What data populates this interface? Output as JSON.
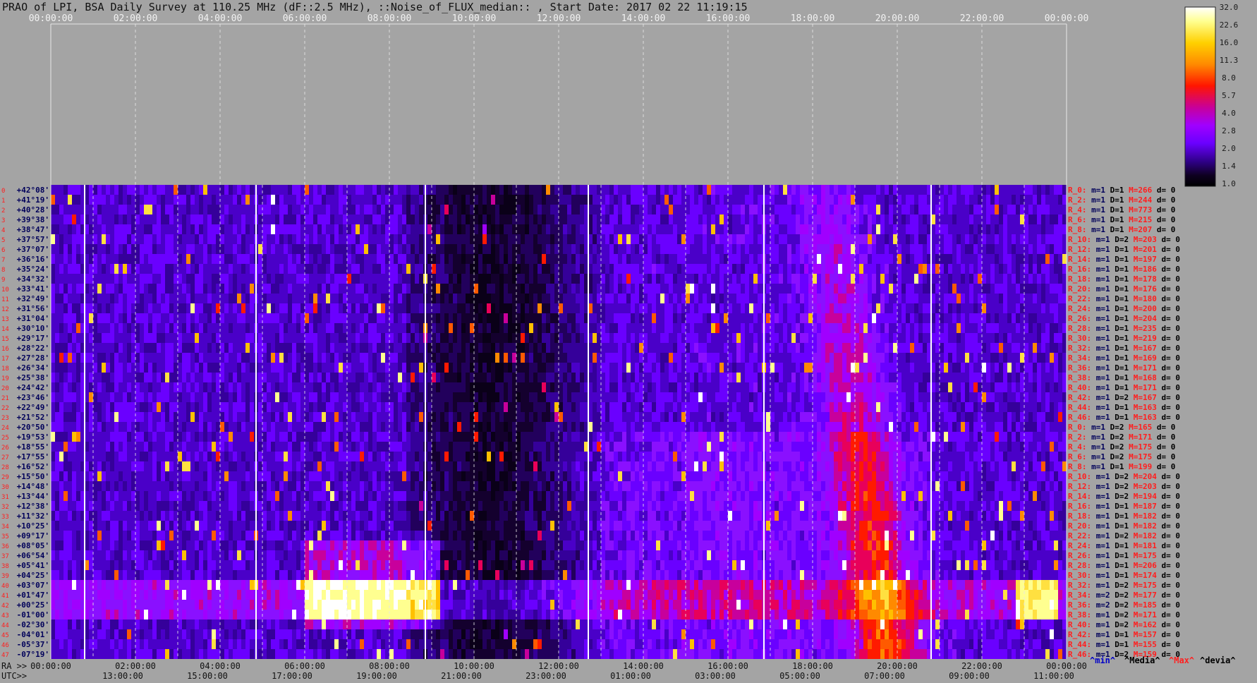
{
  "title": "PRAO of LPI, BSA Daily Survey at 110.25 MHz (dF::2.5 MHz), ::Noise_of_FLUX_median:: , Start Date: 2017 02 22 11:19:15",
  "colorbar": {
    "labels": [
      "32.0",
      "22.6",
      "16.0",
      "11.3",
      "8.0",
      "5.7",
      "4.0",
      "2.8",
      "2.0",
      "1.4",
      "1.0"
    ],
    "colors": [
      "#ffffff",
      "#ffff80",
      "#ffd400",
      "#ff8a00",
      "#ff1a00",
      "#c8008c",
      "#a000ff",
      "#6a00ff",
      "#35009a",
      "#14002e",
      "#000000"
    ]
  },
  "footer": {
    "ra_label": "RA >>",
    "utc_label": "UTC>>",
    "min_label": "^min^",
    "media_label": "^Media^",
    "max_label": "^Max^",
    "devia_label": "^devia^"
  },
  "chart_data": {
    "type": "heatmap",
    "top_time_labels": [
      "00:00:00",
      "02:00:00",
      "04:00:00",
      "06:00:00",
      "08:00:00",
      "10:00:00",
      "12:00:00",
      "14:00:00",
      "16:00:00",
      "18:00:00",
      "20:00:00",
      "22:00:00",
      "00:00:00"
    ],
    "ra_time_labels": [
      "00:00:00",
      "02:00:00",
      "04:00:00",
      "06:00:00",
      "08:00:00",
      "10:00:00",
      "12:00:00",
      "14:00:00",
      "16:00:00",
      "18:00:00",
      "20:00:00",
      "22:00:00",
      "00:00:00"
    ],
    "utc_time_labels": [
      "13:00:00",
      "15:00:00",
      "17:00:00",
      "19:00:00",
      "21:00:00",
      "23:00:00",
      "01:00:00",
      "03:00:00",
      "05:00:00",
      "07:00:00",
      "09:00:00",
      "11:00:00"
    ],
    "declinations": [
      "+42°08'",
      "+41°19'",
      "+40°28'",
      "+39°38'",
      "+38°47'",
      "+37°57'",
      "+37°07'",
      "+36°16'",
      "+35°24'",
      "+34°32'",
      "+33°41'",
      "+32°49'",
      "+31°56'",
      "+31°04'",
      "+30°10'",
      "+29°17'",
      "+28°22'",
      "+27°28'",
      "+26°34'",
      "+25°38'",
      "+24°42'",
      "+23°46'",
      "+22°49'",
      "+21°52'",
      "+20°50'",
      "+19°53'",
      "+18°55'",
      "+17°55'",
      "+16°52'",
      "+15°50'",
      "+14°48'",
      "+13°44'",
      "+12°38'",
      "+11°32'",
      "+10°25'",
      "+09°17'",
      "+08°05'",
      "+06°54'",
      "+05°41'",
      "+04°25'",
      "+03°07'",
      "+01°47'",
      "+00°25'",
      "-01°00'",
      "-02°30'",
      "-04°01'",
      "-05°37'",
      "-07°19'"
    ],
    "row_numbers": [
      "0",
      "1",
      "2",
      "3",
      "4",
      "5",
      "6",
      "7",
      "8",
      "9",
      "10",
      "11",
      "12",
      "13",
      "14",
      "15",
      "16",
      "17",
      "18",
      "19",
      "20",
      "21",
      "22",
      "23",
      "24",
      "25",
      "26",
      "27",
      "28",
      "29",
      "30",
      "31",
      "32",
      "33",
      "34",
      "35",
      "36",
      "37",
      "38",
      "39",
      "40",
      "41",
      "42",
      "43",
      "44",
      "45",
      "46",
      "47"
    ],
    "right_stats": [
      {
        "r": "R_0:",
        "min": "m=1",
        "d1": "D=1",
        "max": "M=266",
        "dev": "d= 0"
      },
      {
        "r": "R_2:",
        "min": "m=1",
        "d1": "D=1",
        "max": "M=244",
        "dev": "d= 0"
      },
      {
        "r": "R_4:",
        "min": "m=1",
        "d1": "D=1",
        "max": "M=773",
        "dev": "d= 0"
      },
      {
        "r": "R_6:",
        "min": "m=1",
        "d1": "D=1",
        "max": "M=215",
        "dev": "d= 0"
      },
      {
        "r": "R_8:",
        "min": "m=1",
        "d1": "D=1",
        "max": "M=207",
        "dev": "d= 0"
      },
      {
        "r": "R_10:",
        "min": "m=1",
        "d1": "D=2",
        "max": "M=203",
        "dev": "d= 0"
      },
      {
        "r": "R_12:",
        "min": "m=1",
        "d1": "D=1",
        "max": "M=201",
        "dev": "d= 0"
      },
      {
        "r": "R_14:",
        "min": "m=1",
        "d1": "D=1",
        "max": "M=197",
        "dev": "d= 0"
      },
      {
        "r": "R_16:",
        "min": "m=1",
        "d1": "D=1",
        "max": "M=186",
        "dev": "d= 0"
      },
      {
        "r": "R_18:",
        "min": "m=1",
        "d1": "D=1",
        "max": "M=178",
        "dev": "d= 0"
      },
      {
        "r": "R_20:",
        "min": "m=1",
        "d1": "D=1",
        "max": "M=176",
        "dev": "d= 0"
      },
      {
        "r": "R_22:",
        "min": "m=1",
        "d1": "D=1",
        "max": "M=180",
        "dev": "d= 0"
      },
      {
        "r": "R_24:",
        "min": "m=1",
        "d1": "D=1",
        "max": "M=200",
        "dev": "d= 0"
      },
      {
        "r": "R_26:",
        "min": "m=1",
        "d1": "D=1",
        "max": "M=204",
        "dev": "d= 0"
      },
      {
        "r": "R_28:",
        "min": "m=1",
        "d1": "D=1",
        "max": "M=235",
        "dev": "d= 0"
      },
      {
        "r": "R_30:",
        "min": "m=1",
        "d1": "D=1",
        "max": "M=219",
        "dev": "d= 0"
      },
      {
        "r": "R_32:",
        "min": "m=1",
        "d1": "D=1",
        "max": "M=167",
        "dev": "d= 0"
      },
      {
        "r": "R_34:",
        "min": "m=1",
        "d1": "D=1",
        "max": "M=169",
        "dev": "d= 0"
      },
      {
        "r": "R_36:",
        "min": "m=1",
        "d1": "D=1",
        "max": "M=171",
        "dev": "d= 0"
      },
      {
        "r": "R_38:",
        "min": "m=1",
        "d1": "D=1",
        "max": "M=168",
        "dev": "d= 0"
      },
      {
        "r": "R_40:",
        "min": "m=1",
        "d1": "D=1",
        "max": "M=171",
        "dev": "d= 0"
      },
      {
        "r": "R_42:",
        "min": "m=1",
        "d1": "D=2",
        "max": "M=167",
        "dev": "d= 0"
      },
      {
        "r": "R_44:",
        "min": "m=1",
        "d1": "D=1",
        "max": "M=163",
        "dev": "d= 0"
      },
      {
        "r": "R_46:",
        "min": "m=1",
        "d1": "D=1",
        "max": "M=163",
        "dev": "d= 0"
      },
      {
        "r": "R_0:",
        "min": "m=1",
        "d1": "D=2",
        "max": "M=165",
        "dev": "d= 0"
      },
      {
        "r": "R_2:",
        "min": "m=1",
        "d1": "D=2",
        "max": "M=171",
        "dev": "d= 0"
      },
      {
        "r": "R_4:",
        "min": "m=1",
        "d1": "D=2",
        "max": "M=175",
        "dev": "d= 0"
      },
      {
        "r": "R_6:",
        "min": "m=1",
        "d1": "D=2",
        "max": "M=175",
        "dev": "d= 0"
      },
      {
        "r": "R_8:",
        "min": "m=1",
        "d1": "D=1",
        "max": "M=199",
        "dev": "d= 0"
      },
      {
        "r": "R_10:",
        "min": "m=1",
        "d1": "D=2",
        "max": "M=204",
        "dev": "d= 0"
      },
      {
        "r": "R_12:",
        "min": "m=1",
        "d1": "D=2",
        "max": "M=203",
        "dev": "d= 0"
      },
      {
        "r": "R_14:",
        "min": "m=1",
        "d1": "D=2",
        "max": "M=194",
        "dev": "d= 0"
      },
      {
        "r": "R_16:",
        "min": "m=1",
        "d1": "D=1",
        "max": "M=187",
        "dev": "d= 0"
      },
      {
        "r": "R_18:",
        "min": "m=1",
        "d1": "D=1",
        "max": "M=182",
        "dev": "d= 0"
      },
      {
        "r": "R_20:",
        "min": "m=1",
        "d1": "D=1",
        "max": "M=182",
        "dev": "d= 0"
      },
      {
        "r": "R_22:",
        "min": "m=1",
        "d1": "D=2",
        "max": "M=182",
        "dev": "d= 0"
      },
      {
        "r": "R_24:",
        "min": "m=1",
        "d1": "D=1",
        "max": "M=181",
        "dev": "d= 0"
      },
      {
        "r": "R_26:",
        "min": "m=1",
        "d1": "D=1",
        "max": "M=175",
        "dev": "d= 0"
      },
      {
        "r": "R_28:",
        "min": "m=1",
        "d1": "D=1",
        "max": "M=206",
        "dev": "d= 0"
      },
      {
        "r": "R_30:",
        "min": "m=1",
        "d1": "D=1",
        "max": "M=174",
        "dev": "d= 0"
      },
      {
        "r": "R_32:",
        "min": "m=1",
        "d1": "D=2",
        "max": "M=175",
        "dev": "d= 0"
      },
      {
        "r": "R_34:",
        "min": "m=2",
        "d1": "D=2",
        "max": "M=177",
        "dev": "d= 0"
      },
      {
        "r": "R_36:",
        "min": "m=2",
        "d1": "D=2",
        "max": "M=185",
        "dev": "d= 0"
      },
      {
        "r": "R_38:",
        "min": "m=1",
        "d1": "D=2",
        "max": "M=171",
        "dev": "d= 0"
      },
      {
        "r": "R_40:",
        "min": "m=1",
        "d1": "D=2",
        "max": "M=162",
        "dev": "d= 0"
      },
      {
        "r": "R_42:",
        "min": "m=1",
        "d1": "D=1",
        "max": "M=157",
        "dev": "d= 0"
      },
      {
        "r": "R_44:",
        "min": "m=1",
        "d1": "D=1",
        "max": "M=155",
        "dev": "d= 0"
      },
      {
        "r": "R_46:",
        "min": "m=1",
        "d1": "D=2",
        "max": "M=159",
        "dev": "d= 0"
      }
    ]
  }
}
